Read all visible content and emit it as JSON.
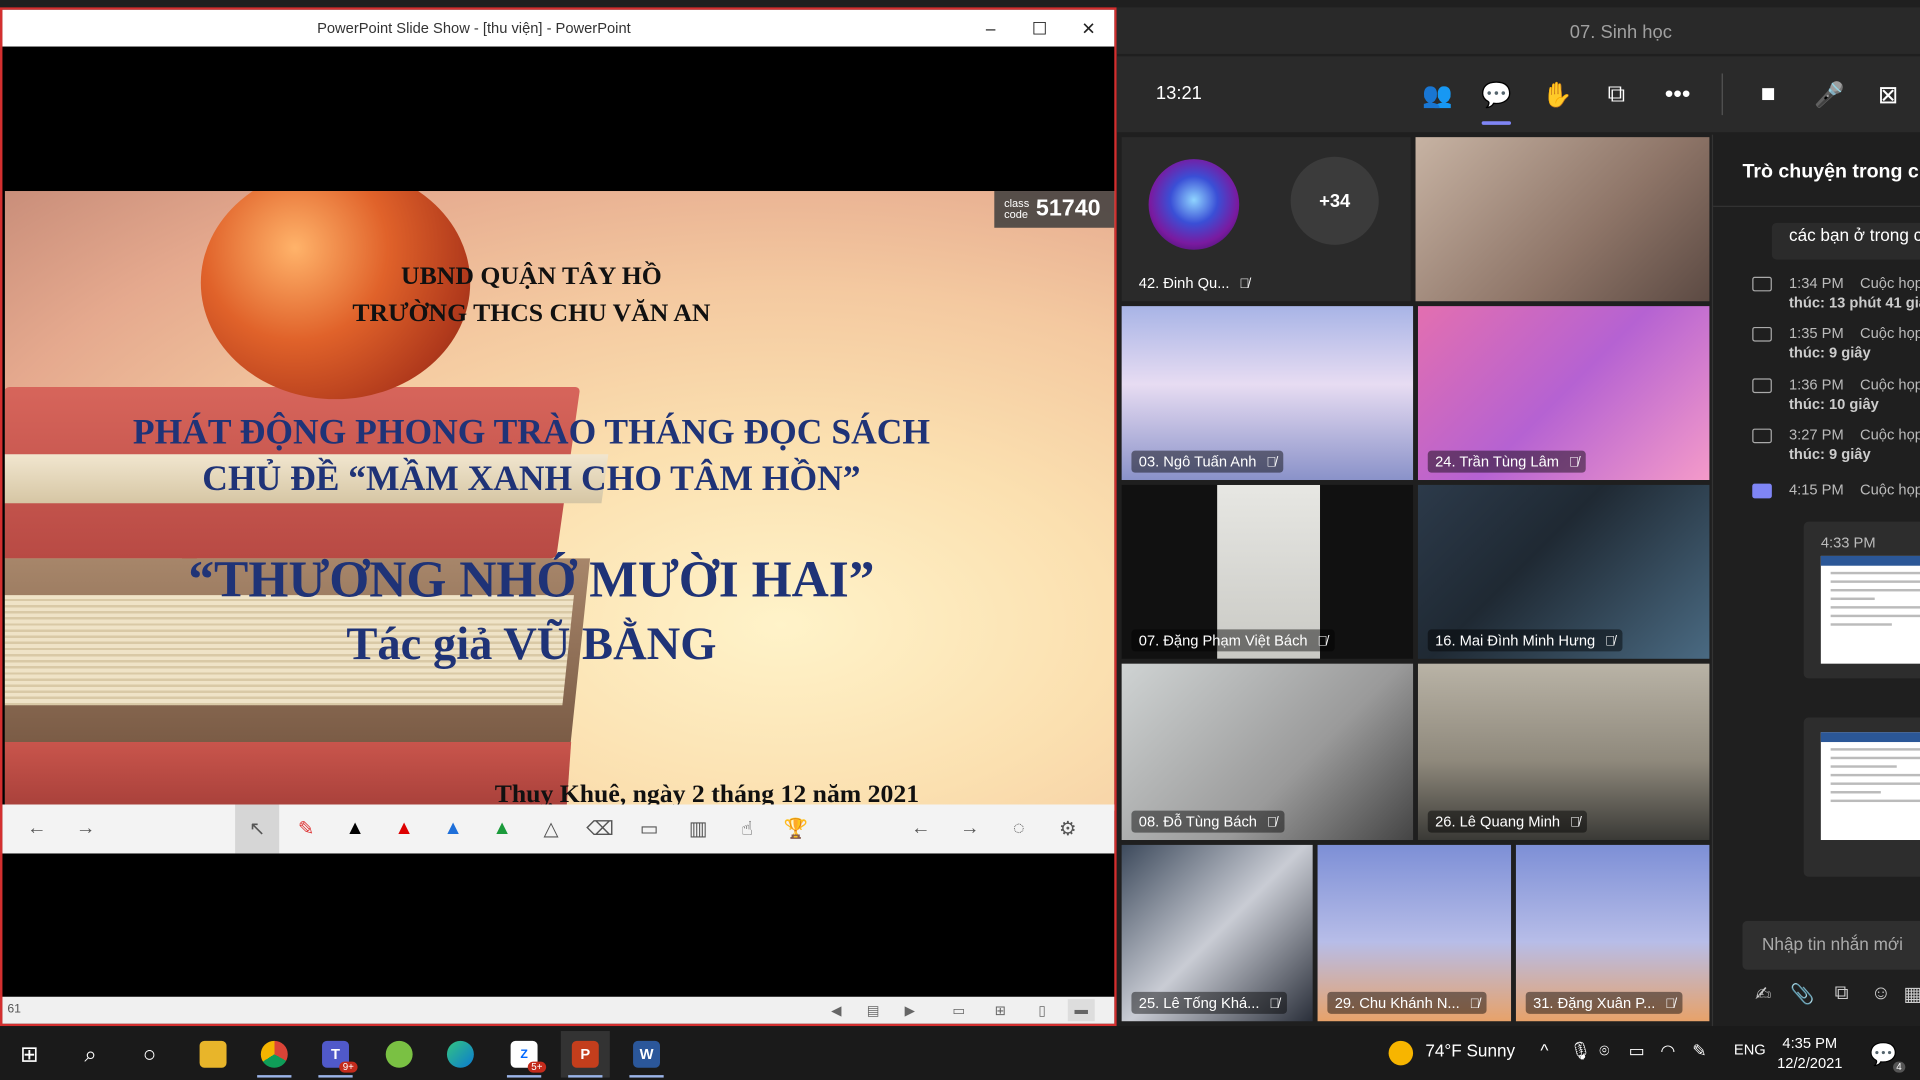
{
  "ppt": {
    "window_title": "PowerPoint Slide Show - [thu viện] - PowerPoint",
    "minimize": "‒",
    "maximize": "☐",
    "close": "✕",
    "slide": {
      "class_label_1": "class",
      "class_label_2": "code",
      "class_code": "51740",
      "line1": "UBND QUẬN TÂY HỒ",
      "line2": "TRƯỜNG THCS CHU VĂN AN",
      "line3": "PHÁT ĐỘNG PHONG TRÀO THÁNG ĐỌC SÁCH",
      "line4": "CHỦ ĐỀ “MẦM XANH CHO TÂM HỒN”",
      "line5": "“THƯƠNG NHỚ MƯỜI HAI”",
      "line6": "Tác giả VŨ BẰNG",
      "date": "Thuỵ Khuê, ngày 2 tháng 12 năm 2021"
    },
    "status": {
      "slide_number": "61"
    }
  },
  "teams": {
    "meeting_title": "07. Sinh học",
    "timer": "13:21",
    "overflow_label": "+34",
    "participants": [
      "42. Đinh Qu...",
      "03. Ngô Tuấn Anh",
      "24. Trần Tùng Lâm",
      "07. Đặng Phạm Việt Bách",
      "16. Mai Đình Minh Hưng",
      "08. Đỗ Tùng Bách",
      "26. Lê Quang Minh",
      "25. Lê Tống Khá...",
      "29. Chu Khánh N...",
      "31. Đặng Xuân P..."
    ],
    "chat": {
      "title": "Trò chuyện trong c",
      "message": "các bạn ở trong c",
      "events": [
        {
          "time": "1:34 PM",
          "desc": "Cuộc họp",
          "duration": "thúc: 13 phút 41 giâ"
        },
        {
          "time": "1:35 PM",
          "desc": "Cuộc họp",
          "duration": "thúc: 9 giây"
        },
        {
          "time": "1:36 PM",
          "desc": "Cuộc họp",
          "duration": "thúc: 10 giây"
        },
        {
          "time": "3:27 PM",
          "desc": "Cuộc họp",
          "duration": "thúc: 9 giây"
        },
        {
          "time": "4:15 PM",
          "desc": "Cuộc họp",
          "duration": ""
        }
      ],
      "screenshot_time": "4:33 PM",
      "compose_placeholder": "Nhập tin nhắn mới"
    }
  },
  "taskbar": {
    "teams_badge": "9+",
    "zalo_badge": "5+",
    "weather": "74°F  Sunny",
    "language": "ENG",
    "time": "4:35 PM",
    "date": "12/2/2021",
    "notifications": "4"
  }
}
